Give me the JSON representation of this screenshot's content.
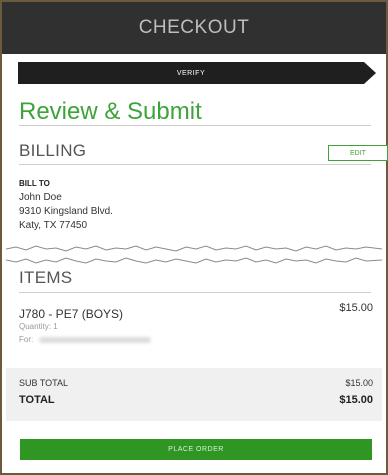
{
  "header": {
    "title": "CHECKOUT"
  },
  "steps": {
    "current": "VERIFY"
  },
  "page": {
    "title": "Review & Submit"
  },
  "billing": {
    "title": "BILLING",
    "edit_label": "EDIT",
    "bill_to_label": "BILL TO",
    "name": "John Doe",
    "street": "9310 Kingsland Blvd.",
    "city_state_zip": "Katy, TX 77450"
  },
  "items": {
    "title": "ITEMS",
    "list": [
      {
        "name": "J780 - PE7 (BOYS)",
        "price": "$15.00",
        "quantity": "Quantity: 1",
        "for_label": "For:"
      }
    ]
  },
  "totals": {
    "subtotal_label": "SUB TOTAL",
    "subtotal_value": "$15.00",
    "total_label": "TOTAL",
    "total_value": "$15.00"
  },
  "actions": {
    "place_order_label": "PLACE ORDER"
  },
  "colors": {
    "accent": "#3ea33a",
    "button": "#2f9624",
    "header_bg": "#303030"
  }
}
